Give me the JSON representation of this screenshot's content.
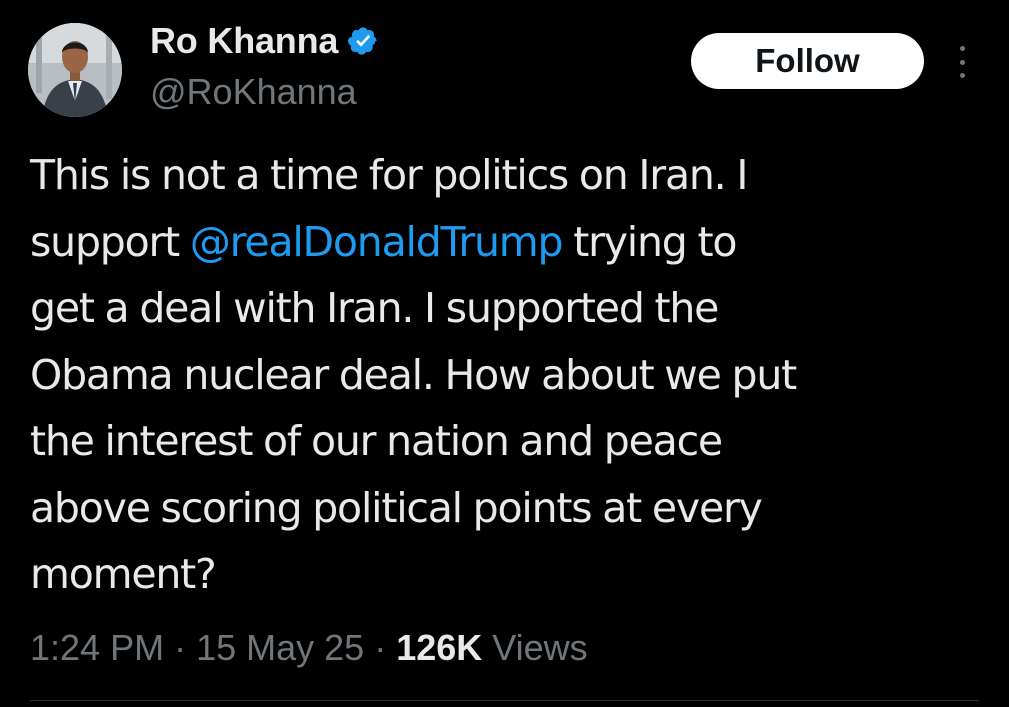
{
  "author": {
    "display_name": "Ro Khanna",
    "handle": "@RoKhanna",
    "verified": true,
    "verified_badge_color": "#1d9bf0"
  },
  "actions": {
    "follow_label": "Follow",
    "more_icon": "more-vertical-icon"
  },
  "tweet": {
    "lines": [
      {
        "before": "This is not a time for politics on Iran. I",
        "mention": "",
        "after": ""
      },
      {
        "before": "support ",
        "mention": "@realDonaldTrump",
        "after": " trying to"
      },
      {
        "before": "get a deal with Iran. I supported the",
        "mention": "",
        "after": ""
      },
      {
        "before": "Obama nuclear deal. How about we put",
        "mention": "",
        "after": ""
      },
      {
        "before": "the interest of our nation and peace",
        "mention": "",
        "after": ""
      },
      {
        "before": "above scoring political points at every",
        "mention": "",
        "after": ""
      },
      {
        "before": "moment?",
        "mention": "",
        "after": ""
      }
    ],
    "mention_color": "#1d9bf0"
  },
  "meta": {
    "time": "1:24 PM",
    "separator": "·",
    "date": "15 May 25",
    "views_count": "126K",
    "views_label": "Views"
  },
  "colors": {
    "background": "#000000",
    "primary_text": "#e7e9ea",
    "secondary_text": "#71767b",
    "follow_button_bg": "#ffffff",
    "follow_button_text": "#0f1419"
  }
}
